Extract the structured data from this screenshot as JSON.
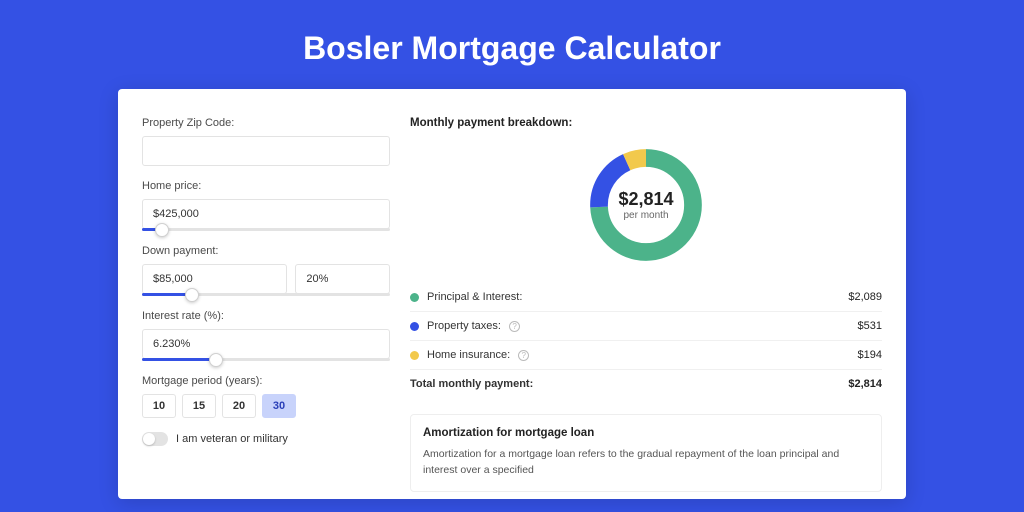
{
  "title": "Bosler Mortgage Calculator",
  "form": {
    "zip_label": "Property Zip Code:",
    "zip_value": "",
    "home_price_label": "Home price:",
    "home_price_value": "$425,000",
    "home_price_slider_pct": 8,
    "down_label": "Down payment:",
    "down_value": "$85,000",
    "down_pct_value": "20%",
    "down_slider_pct": 20,
    "rate_label": "Interest rate (%):",
    "rate_value": "6.230%",
    "rate_slider_pct": 30,
    "period_label": "Mortgage period (years):",
    "periods": [
      "10",
      "15",
      "20",
      "30"
    ],
    "period_active_index": 3,
    "veteran_label": "I am veteran or military"
  },
  "breakdown": {
    "title": "Monthly payment breakdown:",
    "center_amount": "$2,814",
    "center_sub": "per month",
    "rows": [
      {
        "name": "Principal & Interest:",
        "value": "$2,089",
        "color": "#4cb38a",
        "info": false
      },
      {
        "name": "Property taxes:",
        "value": "$531",
        "color": "#3451e4",
        "info": true
      },
      {
        "name": "Home insurance:",
        "value": "$194",
        "color": "#f2c94c",
        "info": true
      }
    ],
    "total_label": "Total monthly payment:",
    "total_value": "$2,814"
  },
  "amort": {
    "title": "Amortization for mortgage loan",
    "text": "Amortization for a mortgage loan refers to the gradual repayment of the loan principal and interest over a specified"
  },
  "chart_data": {
    "type": "pie",
    "title": "Monthly payment breakdown",
    "series": [
      {
        "name": "Principal & Interest",
        "value": 2089,
        "color": "#4cb38a"
      },
      {
        "name": "Property taxes",
        "value": 531,
        "color": "#3451e4"
      },
      {
        "name": "Home insurance",
        "value": 194,
        "color": "#f2c94c"
      }
    ],
    "total": 2814,
    "center_label": "$2,814 per month"
  }
}
